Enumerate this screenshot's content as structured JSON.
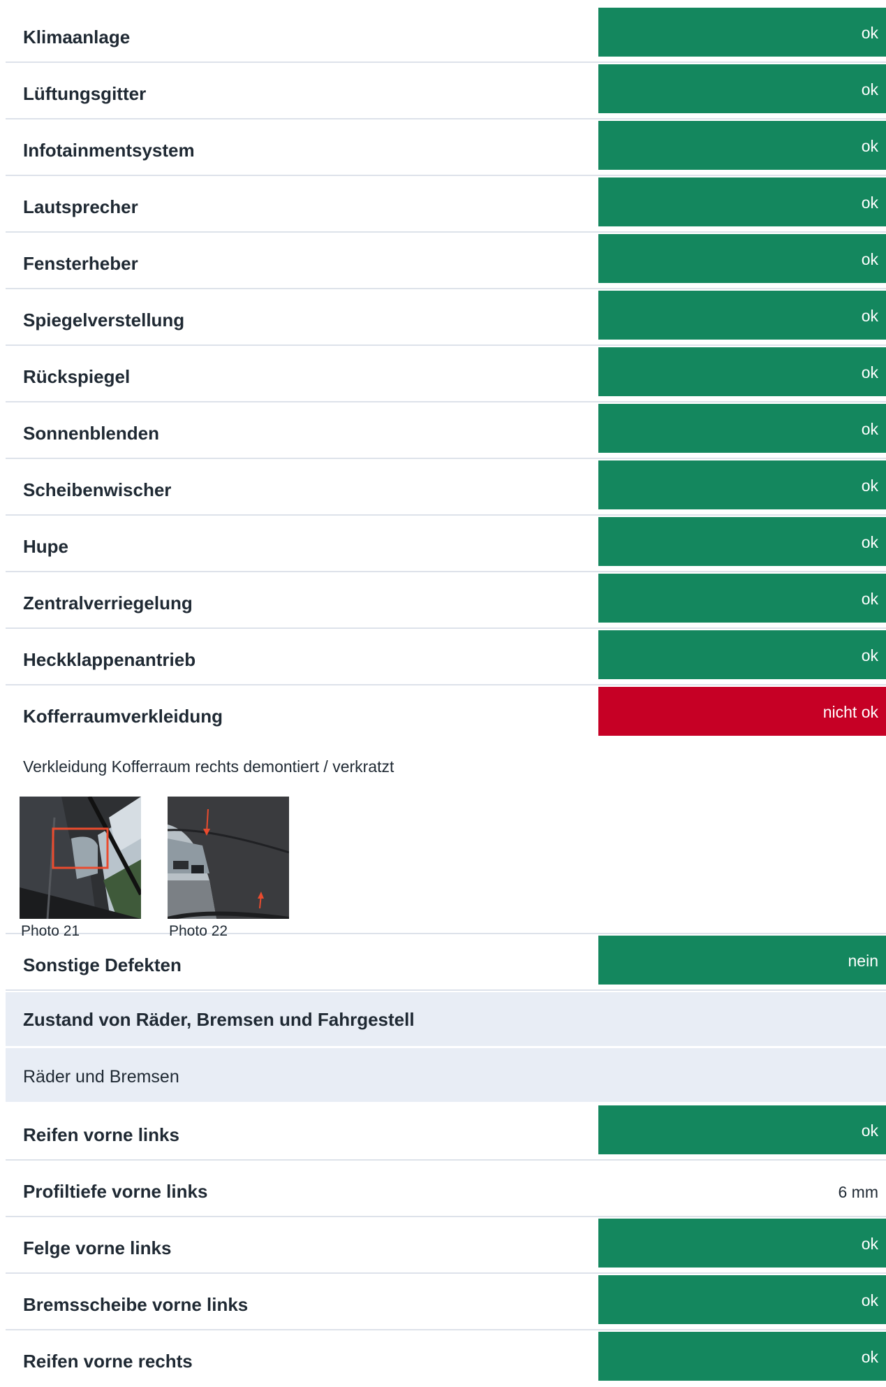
{
  "checks_top": [
    {
      "label": "Klimaanlage",
      "status": "ok"
    },
    {
      "label": "Lüftungsgitter",
      "status": "ok"
    },
    {
      "label": "Infotainmentsystem",
      "status": "ok"
    },
    {
      "label": "Lautsprecher",
      "status": "ok"
    },
    {
      "label": "Fensterheber",
      "status": "ok"
    },
    {
      "label": "Spiegelverstellung",
      "status": "ok"
    },
    {
      "label": "Rückspiegel",
      "status": "ok"
    },
    {
      "label": "Sonnenblenden",
      "status": "ok"
    },
    {
      "label": "Scheibenwischer",
      "status": "ok"
    },
    {
      "label": "Hupe",
      "status": "ok"
    },
    {
      "label": "Zentralverriegelung",
      "status": "ok"
    },
    {
      "label": "Heckklappenantrieb",
      "status": "ok"
    }
  ],
  "defect_item": {
    "label": "Kofferraumverkleidung",
    "status": "nicht ok",
    "status_color": "#c60025",
    "note": "Verkleidung Kofferraum rechts demontiert / verkratzt",
    "photos": [
      {
        "caption": "Photo 21"
      },
      {
        "caption": "Photo 22"
      }
    ]
  },
  "other_defects": {
    "label": "Sonstige Defekten",
    "status": "nein"
  },
  "section": {
    "title": "Zustand von Räder, Bremsen und Fahrgestell",
    "subtitle": "Räder und Bremsen"
  },
  "checks_wheels": [
    {
      "label": "Reifen vorne links",
      "status": "ok"
    },
    {
      "label": "Profiltiefe vorne links",
      "value": "6 mm"
    },
    {
      "label": "Felge vorne links",
      "status": "ok"
    },
    {
      "label": "Bremsscheibe vorne links",
      "status": "ok"
    },
    {
      "label": "Reifen vorne rechts",
      "status": "ok"
    }
  ],
  "colors": {
    "ok": "#14875e",
    "not_ok": "#c60025",
    "section_bg": "#e8edf5",
    "divider": "#dde2ea"
  }
}
